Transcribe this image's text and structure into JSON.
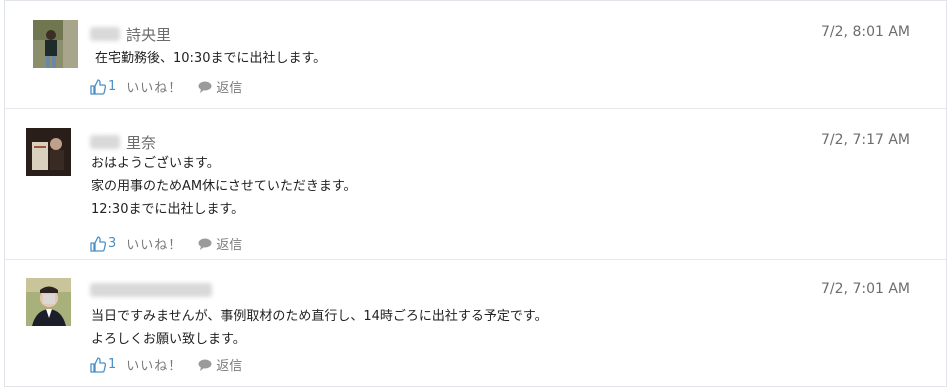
{
  "posts": [
    {
      "name": "詩央里",
      "time": "7/2, 8:01 AM",
      "lines": [
        "在宅勤務後、10:30までに出社します。"
      ],
      "likes": "1",
      "like_label": "いいね！",
      "reply_label": "返信"
    },
    {
      "name": "里奈",
      "time": "7/2, 7:17 AM",
      "lines": [
        "おはようございます。",
        "家の用事のためAM休にさせていただきます。",
        "12:30までに出社します。"
      ],
      "likes": "3",
      "like_label": "いいね！",
      "reply_label": "返信"
    },
    {
      "name": "",
      "time": "7/2, 7:01 AM",
      "lines": [
        "当日ですみませんが、事例取材のため直行し、14時ごろに出社する予定です。",
        "よろしくお願い致します。"
      ],
      "likes": "1",
      "like_label": "いいね！",
      "reply_label": "返信"
    }
  ],
  "icons": {
    "like": "thumbs-up-icon",
    "reply": "speech-bubble-icon"
  },
  "colors": {
    "accent": "#4a90c8",
    "muted": "#7a7a7a",
    "border": "#e1e4e8"
  }
}
